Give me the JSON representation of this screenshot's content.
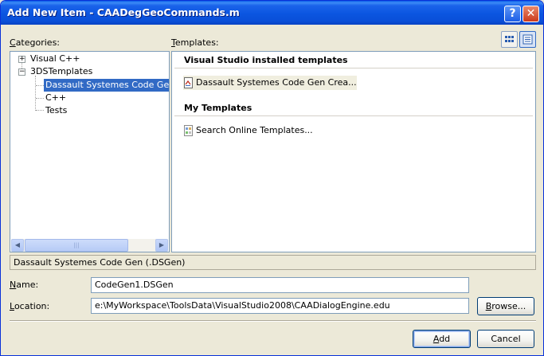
{
  "window": {
    "title": "Add New Item - CAADegGeoCommands.m",
    "help_glyph": "?",
    "close_glyph": "✕"
  },
  "categories": {
    "label_first": "C",
    "label_rest": "ategories:",
    "tree": [
      {
        "label": "Visual C++",
        "expander": "+"
      },
      {
        "label": "3DSTemplates",
        "expander": "−"
      },
      {
        "label": "Dassault Systemes Code Gen Cr"
      },
      {
        "label": "C++"
      },
      {
        "label": "Tests"
      }
    ],
    "scroll_left": "◀",
    "scroll_right": "▶",
    "scroll_grip": "|||"
  },
  "templates": {
    "label_first": "T",
    "label_rest": "emplates:",
    "view_icons": [
      "large-icons-view-icon",
      "list-view-icon"
    ],
    "groups": [
      {
        "header": "Visual Studio installed templates",
        "items": [
          "Dassault Systemes Code Gen Crea..."
        ]
      },
      {
        "header": "My Templates",
        "items": [
          "Search Online Templates..."
        ]
      }
    ]
  },
  "description": "Dassault Systemes Code Gen (.DSGen)",
  "name_field": {
    "label_first": "N",
    "label_rest": "ame:",
    "value": "CodeGen1.DSGen"
  },
  "location_field": {
    "label_first": "L",
    "label_rest": "ocation:",
    "value": "e:\\MyWorkspace\\ToolsData\\VisualStudio2008\\CAADialogEngine.edu"
  },
  "buttons": {
    "browse_first": "B",
    "browse_rest": "rowse...",
    "add_first": "A",
    "add_rest": "dd",
    "cancel": "Cancel"
  },
  "colors": {
    "titlebar": "#0a55e0",
    "selection": "#316ac5",
    "dialog_bg": "#ece9d8"
  }
}
